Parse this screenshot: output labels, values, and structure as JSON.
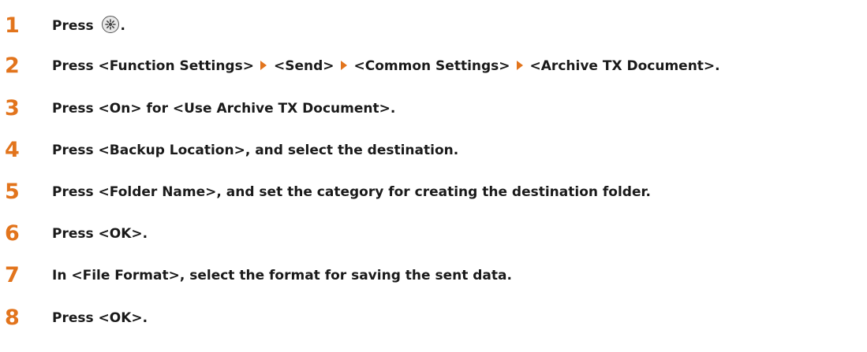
{
  "colors": {
    "accent": "#e2741c",
    "text": "#1a1a1a"
  },
  "steps": [
    {
      "number": "1",
      "before": "Press",
      "icon": "settings-menu-icon",
      "after": "."
    },
    {
      "number": "2",
      "segments": [
        "Press <Function Settings>",
        "<Send>",
        "<Common Settings>",
        "<Archive TX Document>."
      ]
    },
    {
      "number": "3",
      "text": "Press <On> for <Use Archive TX Document>."
    },
    {
      "number": "4",
      "text": "Press <Backup Location>, and select the destination."
    },
    {
      "number": "5",
      "text": "Press <Folder Name>, and set the category for creating the destination folder."
    },
    {
      "number": "6",
      "text": "Press <OK>."
    },
    {
      "number": "7",
      "text": "In <File Format>, select the format for saving the sent data."
    },
    {
      "number": "8",
      "text": "Press <OK>."
    }
  ]
}
